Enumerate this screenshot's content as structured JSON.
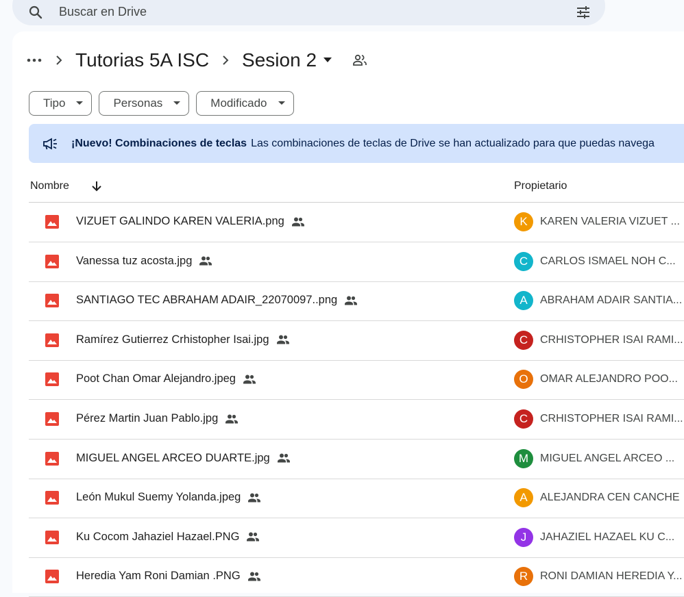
{
  "search": {
    "placeholder": "Buscar en Drive"
  },
  "breadcrumb": {
    "folder": "Tutorias 5A ISC",
    "current": "Sesion 2"
  },
  "filters": [
    "Tipo",
    "Personas",
    "Modificado"
  ],
  "banner": {
    "title": "¡Nuevo! Combinaciones de teclas",
    "message": "Las combinaciones de teclas de Drive se han actualizado para que puedas navega"
  },
  "table": {
    "col_name": "Nombre",
    "col_owner": "Propietario",
    "rows": [
      {
        "name": "VIZUET GALINDO KAREN VALERIA.png",
        "initial": "K",
        "owner": "KAREN VALERIA VIZUET ...",
        "color": "#f29900"
      },
      {
        "name": "Vanessa tuz acosta.jpg",
        "initial": "C",
        "owner": "CARLOS ISMAEL NOH C...",
        "color": "#12b5cb"
      },
      {
        "name": "SANTIAGO TEC ABRAHAM ADAIR_22070097..png",
        "initial": "A",
        "owner": "ABRAHAM ADAIR SANTIA...",
        "color": "#12b5cb"
      },
      {
        "name": "Ramírez Gutierrez Crhistopher Isai.jpg",
        "initial": "C",
        "owner": "CRHISTOPHER ISAI RAMI...",
        "color": "#c5221f"
      },
      {
        "name": "Poot Chan Omar Alejandro.jpeg",
        "initial": "O",
        "owner": "OMAR ALEJANDRO POO...",
        "color": "#e8710a"
      },
      {
        "name": "Pérez Martin Juan Pablo.jpg",
        "initial": "C",
        "owner": "CRHISTOPHER ISAI RAMI...",
        "color": "#c5221f"
      },
      {
        "name": "MIGUEL ANGEL ARCEO DUARTE.jpg",
        "initial": "M",
        "owner": "MIGUEL ANGEL ARCEO ...",
        "color": "#1e8e3e"
      },
      {
        "name": "León Mukul Suemy Yolanda.jpeg",
        "initial": "A",
        "owner": "ALEJANDRA CEN CANCHE",
        "color": "#f29900"
      },
      {
        "name": "Ku Cocom Jahaziel Hazael.PNG",
        "initial": "J",
        "owner": "JAHAZIEL HAZAEL KU C...",
        "color": "#9334e6"
      },
      {
        "name": "Heredia Yam Roni Damian .PNG",
        "initial": "R",
        "owner": "RONI DAMIAN HEREDIA Y...",
        "color": "#e8710a"
      }
    ]
  }
}
